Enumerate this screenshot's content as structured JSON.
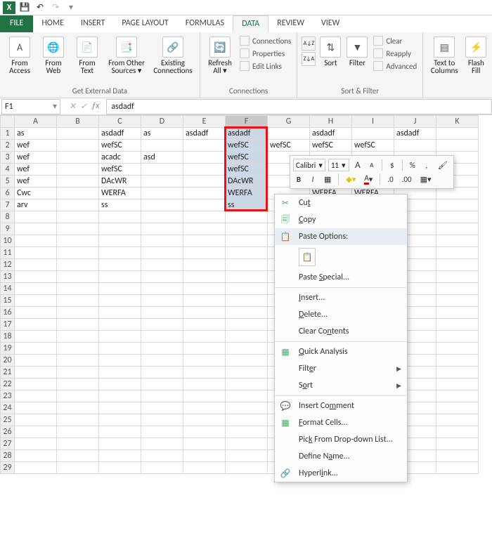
{
  "qat": {
    "save": "💾",
    "undo": "↶",
    "redo": "↷"
  },
  "tabs": {
    "file": "FILE",
    "home": "HOME",
    "insert": "INSERT",
    "pagelayout": "PAGE LAYOUT",
    "formulas": "FORMULAS",
    "data": "DATA",
    "review": "REVIEW",
    "view": "VIEW"
  },
  "ribbon": {
    "ext": {
      "access": "From\nAccess",
      "web": "From\nWeb",
      "text": "From\nText",
      "other": "From Other\nSources ▾",
      "existing": "Existing\nConnections",
      "label": "Get External Data"
    },
    "conn": {
      "refresh": "Refresh\nAll ▾",
      "connections": "Connections",
      "properties": "Properties",
      "editlinks": "Edit Links",
      "label": "Connections"
    },
    "sort": {
      "sort": "Sort",
      "filter": "Filter",
      "clear": "Clear",
      "reapply": "Reapply",
      "advanced": "Advanced",
      "label": "Sort & Filter"
    },
    "tools": {
      "ttc": "Text to\nColumns",
      "flash": "Flash\nFill"
    }
  },
  "namebox": "F1",
  "formula": "asdadf",
  "columns": [
    "A",
    "B",
    "C",
    "D",
    "E",
    "F",
    "G",
    "H",
    "I",
    "J",
    "K"
  ],
  "rows": 29,
  "cells": {
    "1": {
      "A": "as",
      "C": "asdadf",
      "D": "as",
      "E": "asdadf",
      "F": "asdadf",
      "H": "asdadf",
      "J": "asdadf"
    },
    "2": {
      "A": "wef",
      "C": "wefSC",
      "F": "wefSC",
      "G": "wefSC",
      "H": "wefSC",
      "I": "wefSC"
    },
    "3": {
      "A": "wef",
      "C": "acadc",
      "D": "asd",
      "F": "wefSC"
    },
    "4": {
      "A": "wef",
      "C": "wefSC",
      "F": "wefSC"
    },
    "5": {
      "A": "wef",
      "C": "DAcWR",
      "F": "DAcWR"
    },
    "6": {
      "A": "Cwc",
      "C": "WERFA",
      "F": "WERFA",
      "H": "WERFA",
      "I": "WERFA"
    },
    "7": {
      "A": "arv",
      "C": "ss",
      "F": "ss"
    }
  },
  "minitb": {
    "font": "Calibri",
    "size": "11",
    "a_plus": "A",
    "a_minus": "A",
    "currency": "$",
    "percent": "%",
    "comma": ",",
    "paint": "🖌",
    "bold": "B",
    "italic": "I",
    "border": "▦",
    "fontcolor": "A",
    "fill": "◆",
    "inc": ".0",
    "dec": ".00"
  },
  "ctx": {
    "cut": "Cut",
    "copy": "Copy",
    "paste_hdr": "Paste Options:",
    "paste_special": "Paste Special...",
    "insert": "Insert...",
    "delete": "Delete...",
    "clear": "Clear Contents",
    "quick": "Quick Analysis",
    "filter": "Filter",
    "sort": "Sort",
    "comment": "Insert Comment",
    "format": "Format Cells...",
    "pick": "Pick From Drop-down List...",
    "define": "Define Name...",
    "hyper": "Hyperlink..."
  }
}
